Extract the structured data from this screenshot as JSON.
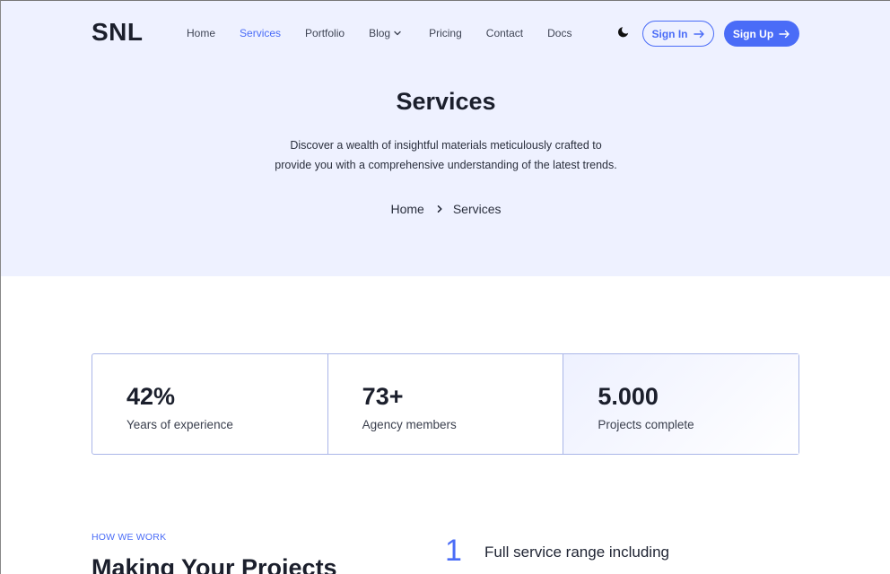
{
  "header": {
    "logo": "SNL",
    "nav": [
      {
        "label": "Home"
      },
      {
        "label": "Services"
      },
      {
        "label": "Portfolio"
      },
      {
        "label": "Blog"
      },
      {
        "label": "Pricing"
      },
      {
        "label": "Contact"
      },
      {
        "label": "Docs"
      }
    ],
    "active_nav": "Services",
    "theme_toggle_icon": "moon-icon",
    "sign_in_label": "Sign In",
    "sign_up_label": "Sign Up"
  },
  "hero": {
    "title": "Services",
    "description_line1": "Discover a wealth of insightful materials meticulously crafted to",
    "description_line2": "provide you with a comprehensive understanding of the latest trends.",
    "breadcrumb": [
      "Home",
      "Services"
    ]
  },
  "stats": [
    {
      "value": "42%",
      "label": "Years of experience"
    },
    {
      "value": "73+",
      "label": "Agency members"
    },
    {
      "value": "5.000",
      "label": "Projects complete"
    }
  ],
  "how_we_work": {
    "eyebrow": "HOW WE WORK",
    "title": "Making Your Projects",
    "steps": [
      {
        "number": "1",
        "title": "Full service range including"
      }
    ]
  },
  "colors": {
    "accent": "#4a6cf7",
    "hero_background": "#eef1ff",
    "text_dark": "#1b1f2c"
  }
}
